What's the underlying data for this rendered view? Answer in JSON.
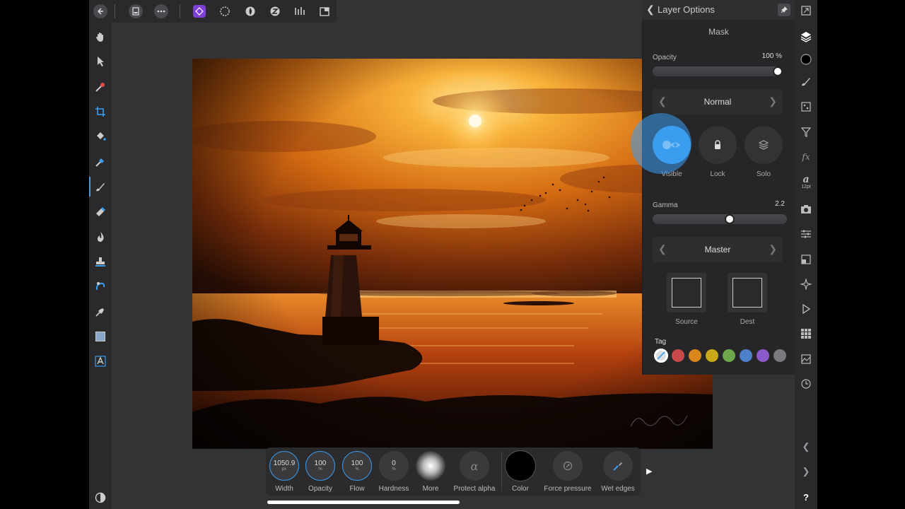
{
  "panel": {
    "title": "Layer Options",
    "header": "Mask",
    "opacity_label": "Opacity",
    "opacity_value": "100 %",
    "opacity_fraction": 1.0,
    "blend_mode": "Normal",
    "buttons": [
      "Visible",
      "Lock",
      "Solo"
    ],
    "gamma_label": "Gamma",
    "gamma_value": "2.2",
    "gamma_fraction": 0.58,
    "channel": "Master",
    "source_label": "Source",
    "dest_label": "Dest",
    "tag_label": "Tag",
    "tag_colors": [
      "#c84a4a",
      "#d9861a",
      "#c9a91a",
      "#6da84a",
      "#4e7fc9",
      "#8a5ac9",
      "#7a7a7e"
    ]
  },
  "context_bar": {
    "width_value": "1050.9",
    "width_unit": "px",
    "width_label": "Width",
    "opacity_value": "100",
    "opacity_unit": "%",
    "opacity_label": "Opacity",
    "flow_value": "100",
    "flow_unit": "%",
    "flow_label": "Flow",
    "hardness_value": "0",
    "hardness_unit": "%",
    "hardness_label": "Hardness",
    "more_label": "More",
    "protect_alpha_label": "Protect alpha",
    "color_label": "Color",
    "force_pressure_label": "Force pressure",
    "wet_edges_label": "Wet edges"
  },
  "studio": {
    "font_size_label": "12pt"
  },
  "colors": {
    "accent": "#3a9df0",
    "panel_bg": "#262628"
  }
}
